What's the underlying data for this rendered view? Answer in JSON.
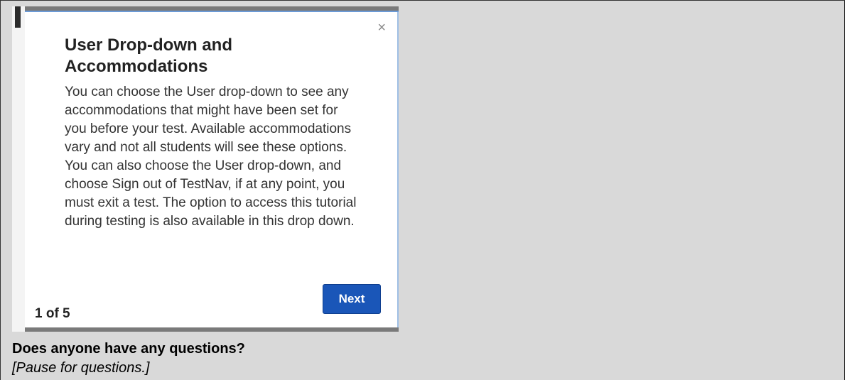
{
  "popup": {
    "title": "User Drop-down and Accommodations",
    "body": "You can choose the User drop-down to see any accommodations that might have been set for you before your test. Available accommodations vary and not all students will see these options. You can also choose the User drop-down, and choose Sign out of TestNav, if at any point, you must exit a test. The option to access this tutorial during testing is also available in this drop down.",
    "close_glyph": "×",
    "page_counter": "1 of 5",
    "next_label": "Next"
  },
  "document": {
    "question": "Does anyone have any questions?",
    "pause_note": "[Pause for questions.]"
  },
  "colors": {
    "cell_background": "#d9d9d9",
    "button_blue": "#1a56b8"
  }
}
